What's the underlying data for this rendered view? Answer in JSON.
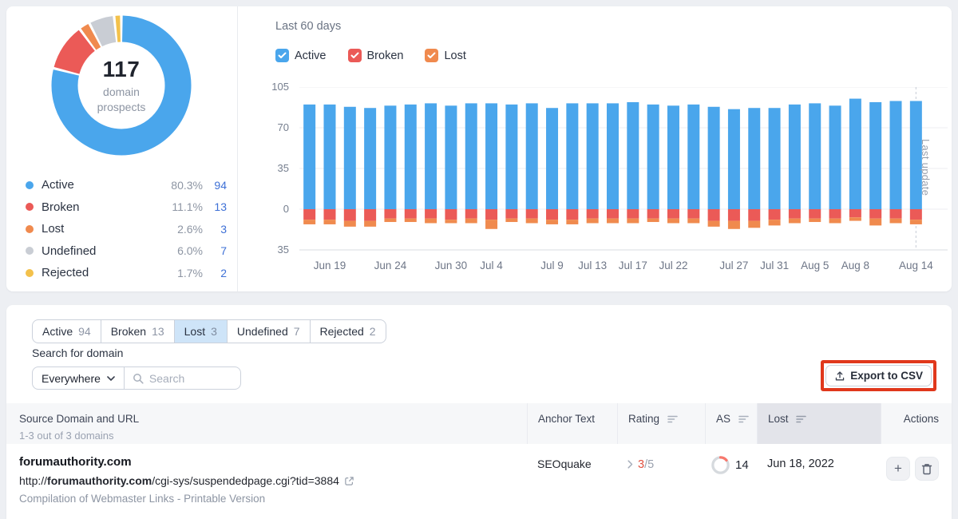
{
  "overview": {
    "total_value": "117",
    "total_label": "domain prospects",
    "legend": [
      {
        "label": "Active",
        "pct": "80.3%",
        "count": "94",
        "color": "#4AA6EC"
      },
      {
        "label": "Broken",
        "pct": "11.1%",
        "count": "13",
        "color": "#EB5A57"
      },
      {
        "label": "Lost",
        "pct": "2.6%",
        "count": "3",
        "color": "#F08A4E"
      },
      {
        "label": "Undefined",
        "pct": "6.0%",
        "count": "7",
        "color": "#C9CDD4"
      },
      {
        "label": "Rejected",
        "pct": "1.7%",
        "count": "2",
        "color": "#F3C14B"
      }
    ]
  },
  "trend": {
    "title": "Last 60 days",
    "filters": [
      {
        "label": "Active",
        "checked": true,
        "color": "#4AA6EC"
      },
      {
        "label": "Broken",
        "checked": true,
        "color": "#EB5A57"
      },
      {
        "label": "Lost",
        "checked": true,
        "color": "#F08A4E"
      }
    ]
  },
  "chart_data": {
    "type": "bar",
    "stacked": true,
    "title": "Last 60 days",
    "ylim": [
      -35,
      105
    ],
    "grid": true,
    "yticks": [
      {
        "value": 105,
        "label": "105"
      },
      {
        "value": 70,
        "label": "70"
      },
      {
        "value": 35,
        "label": "35"
      },
      {
        "value": 0,
        "label": "0"
      },
      {
        "value": -35,
        "label": "35"
      }
    ],
    "x_tick_labels": [
      {
        "index": 1,
        "label": "Jun 19"
      },
      {
        "index": 4,
        "label": "Jun 24"
      },
      {
        "index": 7,
        "label": "Jun 30"
      },
      {
        "index": 9,
        "label": "Jul 4"
      },
      {
        "index": 12,
        "label": "Jul 9"
      },
      {
        "index": 14,
        "label": "Jul 13"
      },
      {
        "index": 16,
        "label": "Jul 17"
      },
      {
        "index": 18,
        "label": "Jul 22"
      },
      {
        "index": 21,
        "label": "Jul 27"
      },
      {
        "index": 23,
        "label": "Jul 31"
      },
      {
        "index": 25,
        "label": "Aug 5"
      },
      {
        "index": 27,
        "label": "Aug 8"
      },
      {
        "index": 30,
        "label": "Aug 14"
      }
    ],
    "series": [
      {
        "name": "Active",
        "color": "#4AA6EC",
        "direction": "up",
        "values": [
          90,
          90,
          88,
          87,
          89,
          90,
          91,
          89,
          91,
          91,
          90,
          91,
          87,
          91,
          91,
          91,
          92,
          90,
          89,
          90,
          88,
          86,
          87,
          87,
          90,
          91,
          89,
          95,
          92,
          93,
          93
        ]
      },
      {
        "name": "Broken",
        "color": "#EB5A57",
        "direction": "down",
        "values": [
          9,
          9,
          10,
          10,
          8,
          8,
          8,
          9,
          8,
          9,
          8,
          8,
          9,
          9,
          8,
          8,
          8,
          8,
          8,
          8,
          10,
          10,
          10,
          9,
          8,
          8,
          8,
          7,
          8,
          8,
          9
        ]
      },
      {
        "name": "Lost",
        "color": "#F08A4E",
        "direction": "down",
        "values": [
          4,
          4,
          5,
          5,
          3,
          3,
          4,
          3,
          4,
          8,
          3,
          4,
          4,
          4,
          4,
          4,
          4,
          3,
          4,
          4,
          5,
          7,
          6,
          5,
          4,
          3,
          4,
          3,
          6,
          4,
          4
        ]
      }
    ],
    "annotation": {
      "label": "Last update",
      "bar_index": 30
    }
  },
  "tabs": [
    {
      "label": "Active",
      "count": "94",
      "selected": false
    },
    {
      "label": "Broken",
      "count": "13",
      "selected": false
    },
    {
      "label": "Lost",
      "count": "3",
      "selected": true
    },
    {
      "label": "Undefined",
      "count": "7",
      "selected": false
    },
    {
      "label": "Rejected",
      "count": "2",
      "selected": false
    }
  ],
  "search": {
    "label": "Search for domain",
    "scope": "Everywhere",
    "placeholder": "Search"
  },
  "export": {
    "label": "Export to CSV",
    "highlight_color": "#E0381C"
  },
  "table": {
    "header": {
      "source": "Source Domain and URL",
      "source_meta": "1-3 out of 3 domains",
      "anchor": "Anchor Text",
      "rating": "Rating",
      "as": "AS",
      "lost": "Lost",
      "actions": "Actions"
    },
    "row": {
      "domain": "forumauthority.com",
      "url_prefix": "http://",
      "url_domain": "forumauthority.com",
      "url_path": "/cgi-sys/suspendedpage.cgi?tid=3884",
      "page_title": "Compilation of Webmaster Links - Printable Version",
      "anchor_text": "SEOquake",
      "rating_value": "3",
      "rating_suffix": "/5",
      "as_value": "14",
      "lost_date": "Jun 18, 2022"
    }
  }
}
